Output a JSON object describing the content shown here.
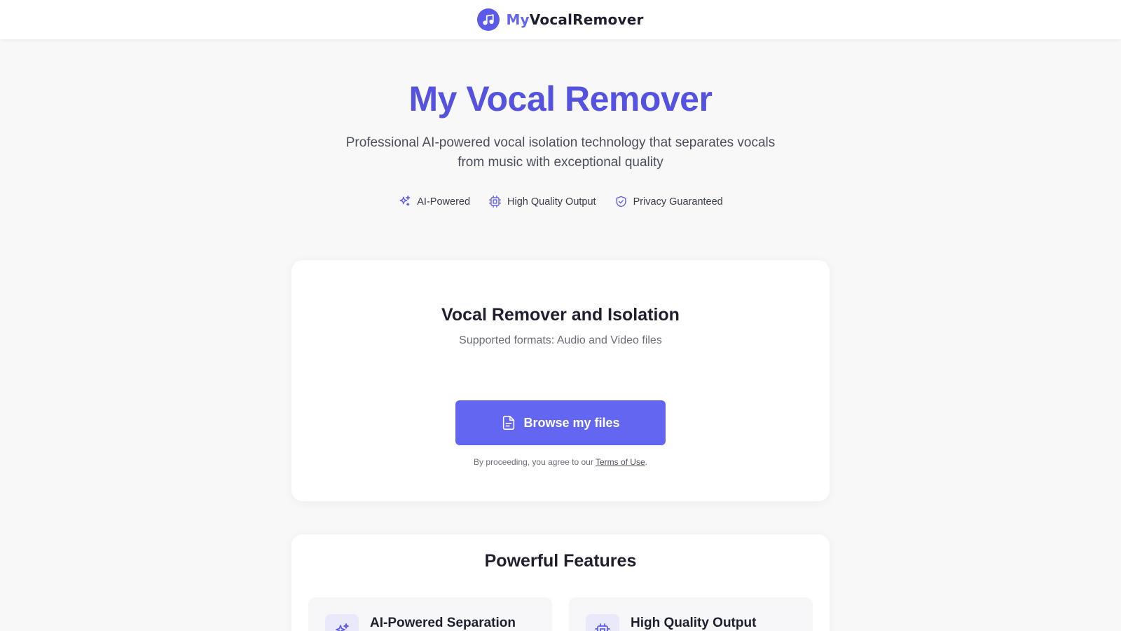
{
  "header": {
    "brand_prefix": "My",
    "brand_suffix": "VocalRemover",
    "logo_icon": "music-note-icon",
    "accent_color": "#6366f1"
  },
  "hero": {
    "title": "My Vocal Remover",
    "subtitle": "Professional AI-powered vocal isolation technology that separates vocals from music with exceptional quality",
    "badges": [
      {
        "icon": "sparkles-icon",
        "label": "AI-Powered"
      },
      {
        "icon": "chip-icon",
        "label": "High Quality Output"
      },
      {
        "icon": "shield-check-icon",
        "label": "Privacy Guaranteed"
      }
    ]
  },
  "upload": {
    "title": "Vocal Remover and Isolation",
    "subtitle": "Supported formats: Audio and Video files",
    "button_label": "Browse my files",
    "button_icon": "file-icon",
    "terms_prefix": "By proceeding, you agree to our ",
    "terms_link": "Terms of Use",
    "terms_suffix": "."
  },
  "features": {
    "title": "Powerful Features",
    "items": [
      {
        "icon": "sparkles-icon",
        "title": "AI-Powered Separation"
      },
      {
        "icon": "chip-icon",
        "title": "High Quality Output"
      }
    ]
  }
}
